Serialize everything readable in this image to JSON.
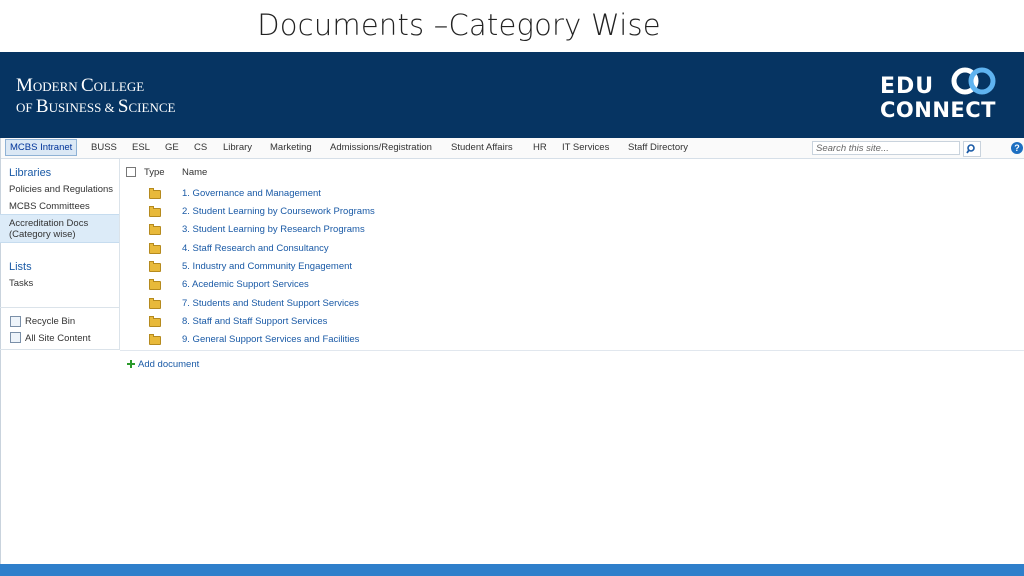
{
  "slide_title": "Documents –Category Wise",
  "banner": {
    "college_line1_first": "M",
    "college_line1_rest": "ODERN ",
    "college_line1_b": "C",
    "college_line1_c": "OLLEGE",
    "college_line2_of": "OF ",
    "college_line2_b": "B",
    "college_line2_c": "USINESS & ",
    "college_line2_d": "S",
    "college_line2_e": "CIENCE",
    "logo_line1": "EDU",
    "logo_line2": "CONNECT"
  },
  "topnav": {
    "tabs": [
      "MCBS Intranet",
      "BUSS",
      "ESL",
      "GE",
      "CS",
      "Library",
      "Marketing",
      "Admissions/Registration",
      "Student Affairs",
      "HR",
      "IT Services",
      "Staff Directory"
    ],
    "active": "MCBS Intranet",
    "search_placeholder": "Search this site...",
    "help": "?"
  },
  "leftnav": {
    "libraries_header": "Libraries",
    "libraries": [
      "Policies and Regulations",
      "MCBS Committees",
      "Accreditation Docs",
      "(Category wise)"
    ],
    "lists_header": "Lists",
    "lists": [
      "Tasks"
    ],
    "recycle_bin": "Recycle Bin",
    "all_site_content": "All Site Content"
  },
  "list": {
    "col_type": "Type",
    "col_name": "Name",
    "items": [
      "1. Governance and Management",
      "2. Student Learning by Coursework Programs",
      "3. Student Learning by Research Programs",
      "4. Staff Research and Consultancy",
      "5. Industry and Community Engagement",
      "6. Acedemic Support Services",
      "7. Students and Student Support Services",
      "8. Staff and Staff Support Services",
      "9. General Support Services and Facilities"
    ],
    "add_document": "Add document"
  },
  "colors": {
    "banner": "#063462",
    "link": "#1a5aa6",
    "bottom_bar": "#2f7fcb"
  }
}
